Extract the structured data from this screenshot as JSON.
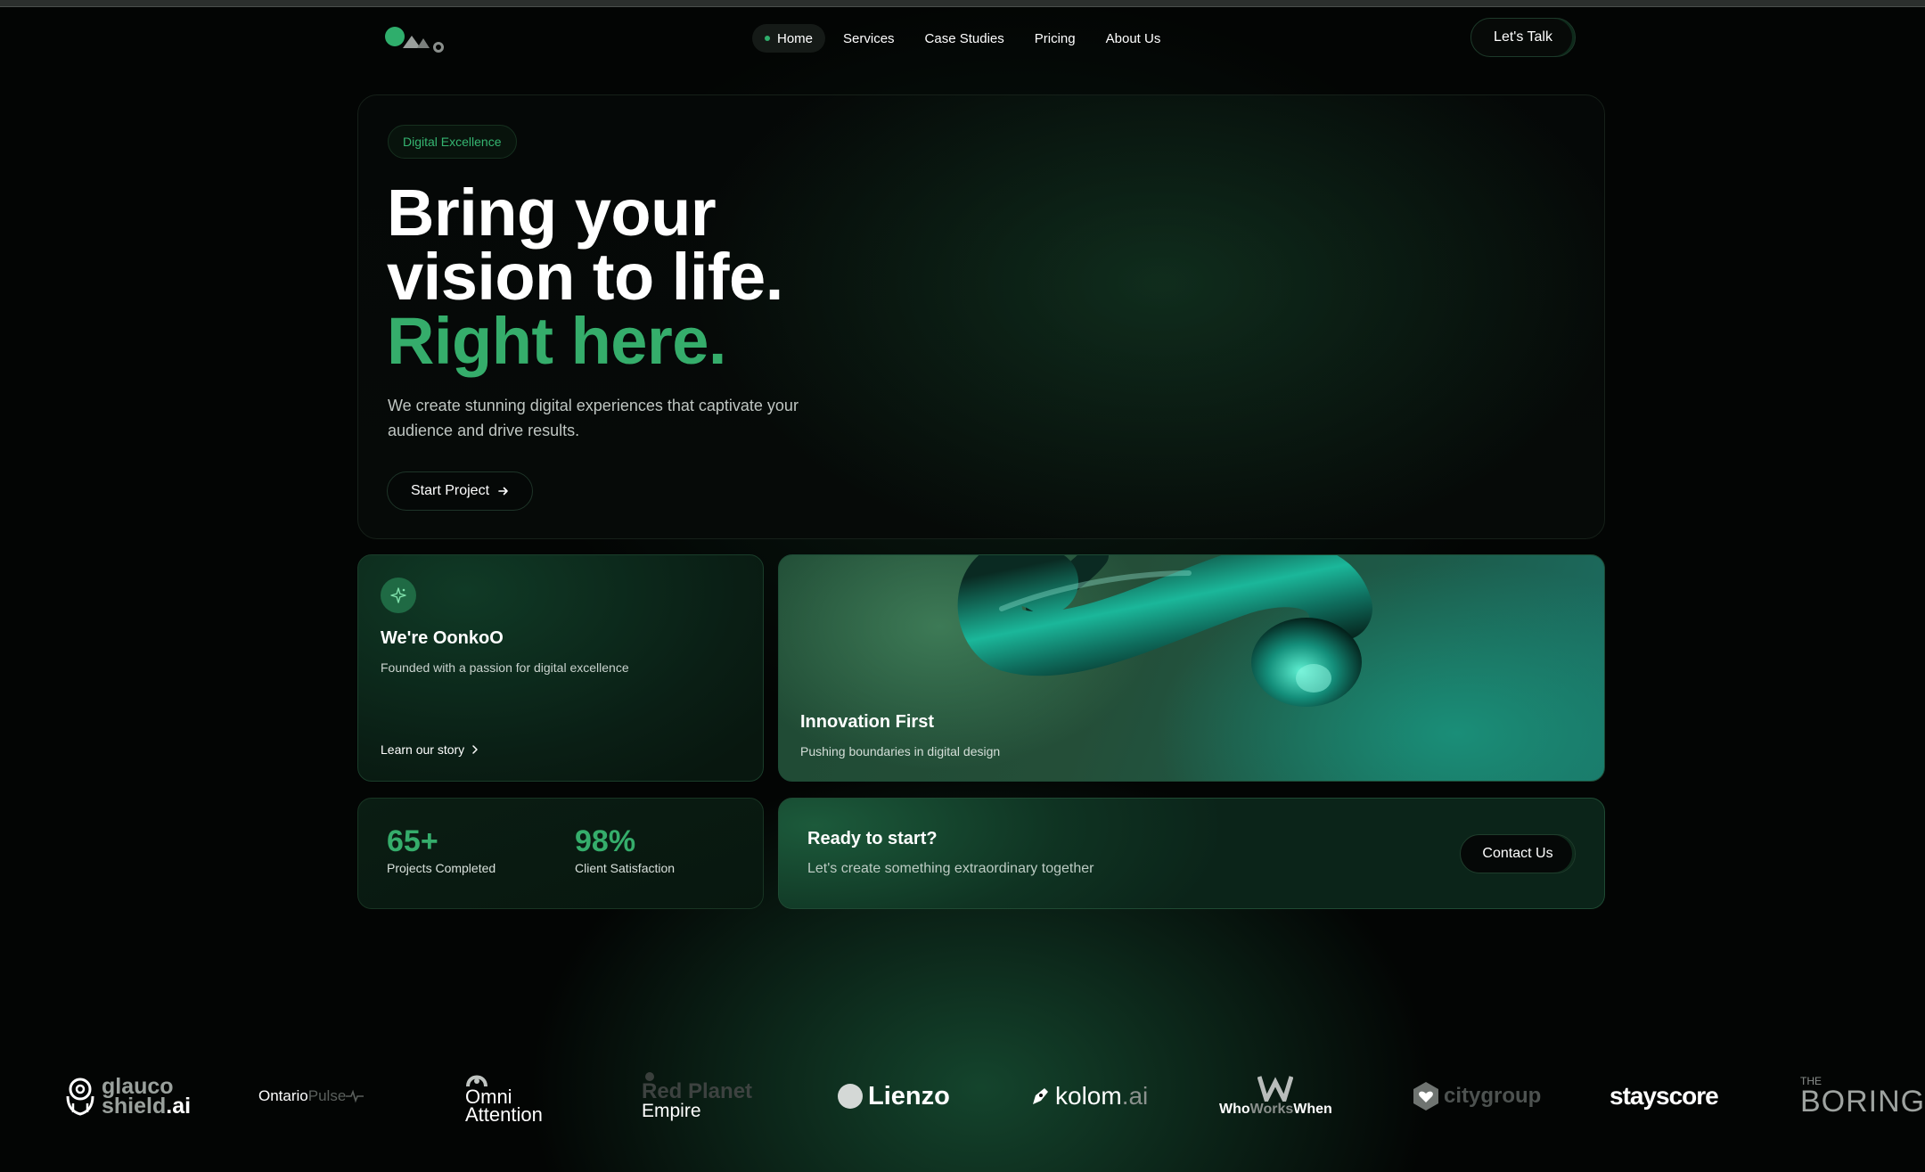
{
  "nav": {
    "items": [
      {
        "label": "Home",
        "active": true
      },
      {
        "label": "Services"
      },
      {
        "label": "Case Studies"
      },
      {
        "label": "Pricing"
      },
      {
        "label": "About Us"
      }
    ],
    "cta_label": "Let's Talk"
  },
  "hero": {
    "badge": "Digital Excellence",
    "headline_line1": "Bring your",
    "headline_line2": "vision to life.",
    "headline_line3": "Right here.",
    "subtitle": "We create stunning digital experiences that captivate your audience and drive results.",
    "button_label": "Start Project"
  },
  "about": {
    "title": "We're OonkoO",
    "subtitle": "Founded with a passion for digital excellence",
    "link_label": "Learn our story"
  },
  "innovation": {
    "title": "Innovation First",
    "subtitle": "Pushing boundaries in digital design"
  },
  "stats": [
    {
      "value": "65+",
      "label": "Projects Completed"
    },
    {
      "value": "98%",
      "label": "Client Satisfaction"
    }
  ],
  "cta": {
    "title": "Ready to start?",
    "subtitle": "Let's create something extraordinary together",
    "button_label": "Contact Us"
  },
  "logos": {
    "glauco_a": "glauco",
    "glauco_b": "shield",
    "glauco_c": ".ai",
    "ontario_a": "Ontario",
    "ontario_b": "Pulse",
    "omni_a": "Omni",
    "omni_b": "Attention",
    "redplanet_a": "Red Planet",
    "redplanet_b": "Empire",
    "lienzo": "Lienzo",
    "kolom_a": "kolom",
    "kolom_b": ".ai",
    "who_a": "Who",
    "who_b": "Works",
    "who_c": "When",
    "citygroup": "citygroup",
    "stayscore": "stayscore",
    "boring_a": "THE",
    "boring_b": "BORING"
  },
  "colors": {
    "accent": "#35ad6b",
    "background": "#030504"
  }
}
